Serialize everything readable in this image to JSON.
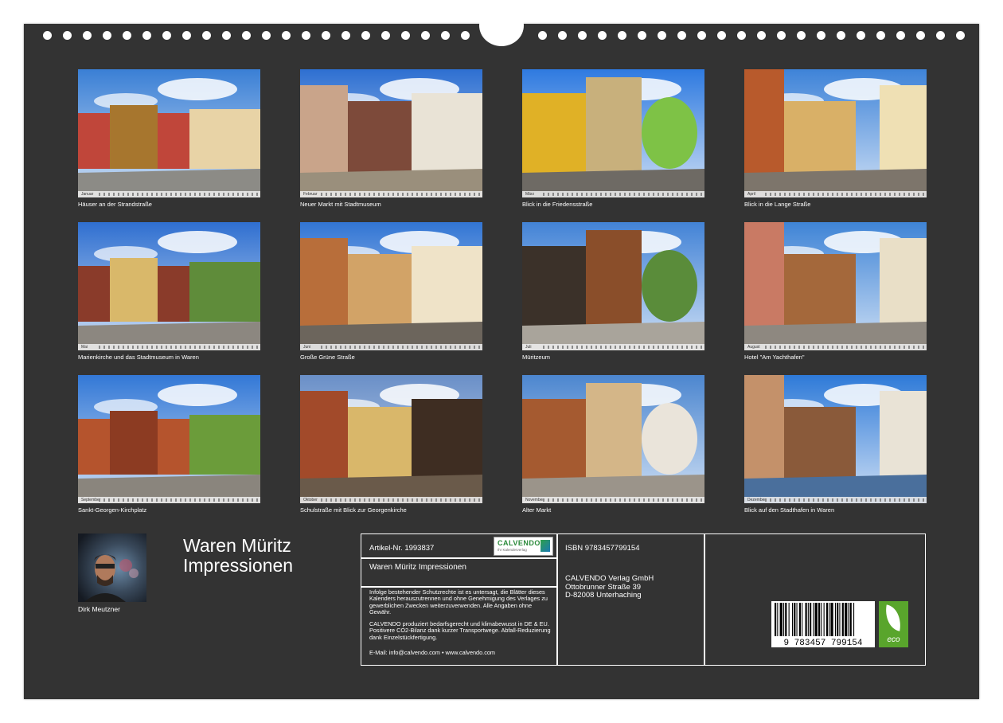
{
  "tiles": [
    {
      "caption": "Häuser an der Strandstraße",
      "month": "Januar",
      "sky": "#3a7fd5",
      "ground": "#8c8b86",
      "b1": "#c0463a",
      "b2": "#a7762e",
      "b3": "#e8d3a6"
    },
    {
      "caption": "Neuer Markt mit Stadtmuseum",
      "month": "Februar",
      "sky": "#2d6fd1",
      "ground": "#9a8f7c",
      "b1": "#c9a48a",
      "b2": "#7d4a3a",
      "b3": "#e9e3d6"
    },
    {
      "caption": "Blick in die Friedensstraße",
      "month": "März",
      "sky": "#2e7ae0",
      "ground": "#6e6a64",
      "b1": "#e0b126",
      "b2": "#c8b07c",
      "b3": "#7ec246"
    },
    {
      "caption": "Blick in die Lange Straße",
      "month": "April",
      "sky": "#3e83d8",
      "ground": "#7d756b",
      "b1": "#b85a2c",
      "b2": "#d9b067",
      "b3": "#efe0b4"
    },
    {
      "caption": "Marienkirche und das Stadtmuseum  in Waren",
      "month": "Mai",
      "sky": "#2f6fd0",
      "ground": "#8c8780",
      "b1": "#8a3b2a",
      "b2": "#d9b86a",
      "b3": "#5f8c3a"
    },
    {
      "caption": "Große Grüne Straße",
      "month": "Juni",
      "sky": "#3275d4",
      "ground": "#6c655c",
      "b1": "#b86e3a",
      "b2": "#d2a367",
      "b3": "#efe3c8"
    },
    {
      "caption": "Müritzeum",
      "month": "Juli",
      "sky": "#4383d6",
      "ground": "#a9a49b",
      "b1": "#3b3129",
      "b2": "#8a4e2a",
      "b3": "#5a8c3a"
    },
    {
      "caption": "Hotel \"Am Yachthafen\"",
      "month": "August",
      "sky": "#3f84d6",
      "ground": "#8e8880",
      "b1": "#c97a64",
      "b2": "#a4683b",
      "b3": "#e9dfc7"
    },
    {
      "caption": "Sankt-Georgen-Kirchplatz",
      "month": "September",
      "sky": "#3378d6",
      "ground": "#8a857d",
      "b1": "#b5542d",
      "b2": "#8c3b22",
      "b3": "#6b9c3a"
    },
    {
      "caption": "Schulstraße mit Blick zur Georgenkirche",
      "month": "Oktober",
      "sky": "#6a8fc7",
      "ground": "#6a5a4a",
      "b1": "#a24a2a",
      "b2": "#d9b76a",
      "b3": "#3e2d22"
    },
    {
      "caption": "Alter Markt",
      "month": "November",
      "sky": "#4c86cf",
      "ground": "#9b948a",
      "b1": "#a55a30",
      "b2": "#d4b688",
      "b3": "#eae4da"
    },
    {
      "caption": "Blick auf den Stadthafen in Waren",
      "month": "Dezember",
      "sky": "#2e7ad8",
      "ground": "#4a6f9c",
      "b1": "#c4916a",
      "b2": "#8a5a3a",
      "b3": "#e9e3d6"
    }
  ],
  "author": {
    "name": "Dirk Meutzner"
  },
  "title": {
    "line1": "Waren Müritz",
    "line2": "Impressionen"
  },
  "info": {
    "artikel": "Artikel-Nr. 1993837",
    "logo_name": "CALVENDO",
    "logo_sub": "Ihr Kalenderverlag",
    "small_title": "Waren Müritz Impressionen",
    "legal1": "Infolge bestehender Schutzrechte ist es untersagt, die Blätter dieses Kalenders herauszutrennen und ohne Genehmigung des Verlages zu gewerblichen Zwecken weiterzuverwenden. Alle Angaben ohne Gewähr.",
    "legal2": "CALVENDO produziert bedarfsgerecht und klimabewusst in DE & EU. Positivere CO2-Bilanz dank kurzer Transportwege. Abfall-Reduzierung dank Einzelstückfertigung.",
    "contact": "E-Mail: info@calvendo.com • www.calvendo.com",
    "isbn": "ISBN 9783457799154",
    "publisher_line1": "CALVENDO Verlag GmbH",
    "publisher_line2": "Ottobrunner Straße 39",
    "publisher_line3": "D-82008 Unterhaching",
    "barcode_digits": "9 783457 799154",
    "eco_label": "eco"
  }
}
